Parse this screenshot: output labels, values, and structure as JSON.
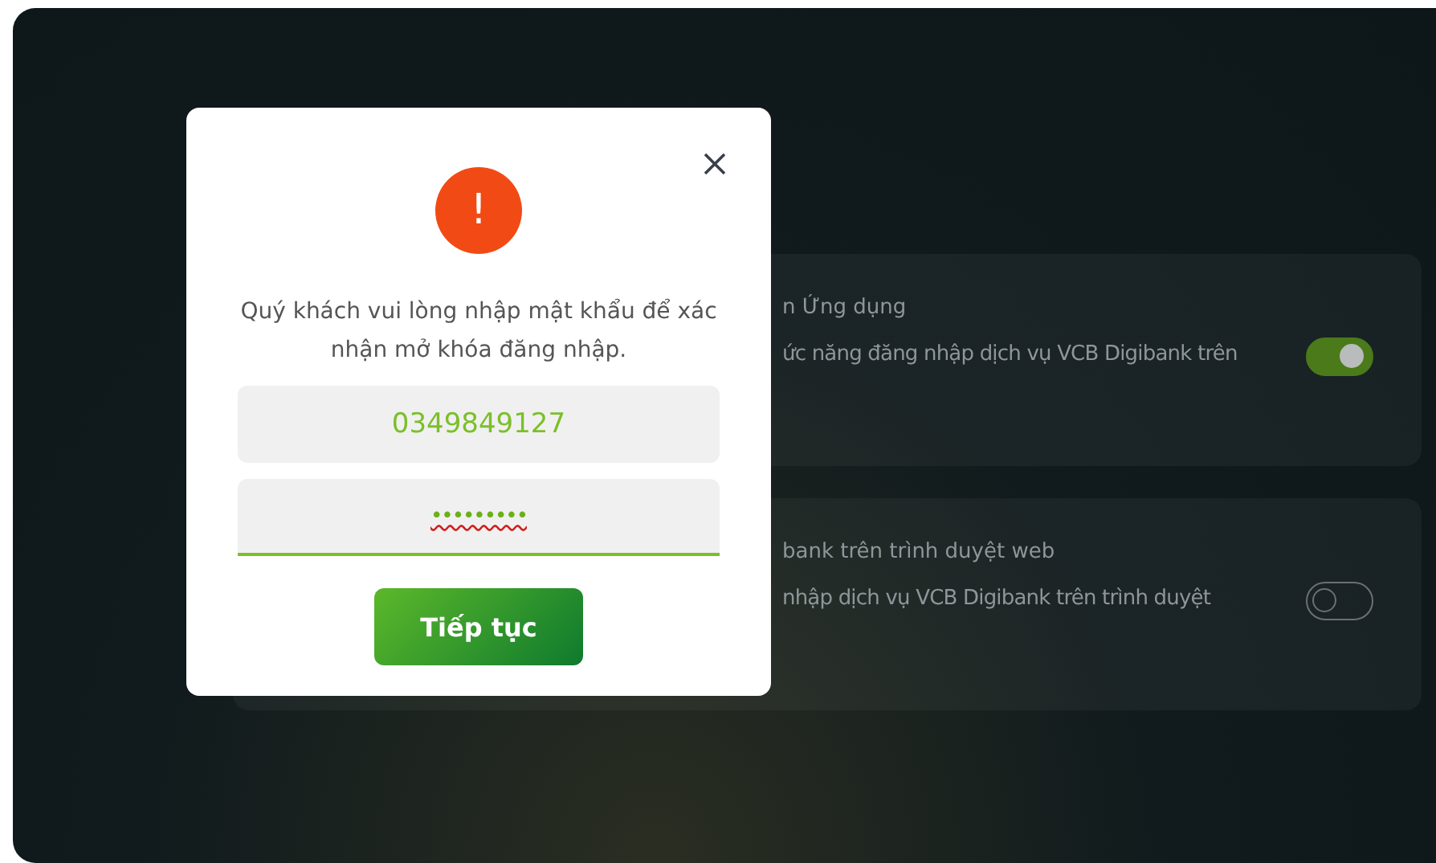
{
  "settings": [
    {
      "title": "n Ứng dụng",
      "description": "ức năng đăng nhập dịch vụ VCB Digibank trên",
      "on": true
    },
    {
      "title": "bank trên trình duyệt web",
      "description": "nhập dịch vụ VCB Digibank trên trình duyệt",
      "on": false
    }
  ],
  "dialog": {
    "icon": "!",
    "message": "Quý khách vui lòng nhập mật khẩu để xác nhận mở khóa đăng nhập.",
    "phone": "0349849127",
    "password": "•••••••••",
    "button": "Tiếp tục"
  }
}
